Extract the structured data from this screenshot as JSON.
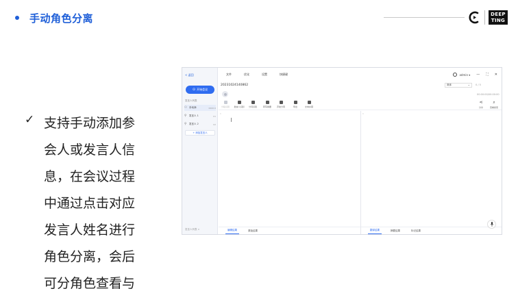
{
  "slide": {
    "title": "手动角色分离",
    "logo": {
      "brand_line1": "DEEP",
      "brand_line2": "TING"
    },
    "check_glyph": "✓",
    "description_lines": [
      "支持手动添加参",
      "会人或发言人信",
      "息，在会议过程",
      "中通过点击对应",
      "发言人姓名进行",
      "角色分离，会后",
      "可分角色查看与"
    ]
  },
  "app": {
    "sidebar": {
      "back_label": "< 返回",
      "start_button": "开始会议",
      "section_label": "发言人列表",
      "speakers": [
        {
          "name": "手动添",
          "count": "0000:0",
          "icon": "user-list-icon"
        },
        {
          "name": "发言人 1",
          "count": "01",
          "icon": "user-icon"
        },
        {
          "name": "发言人 2",
          "count": "02",
          "icon": "user-icon"
        }
      ],
      "add_speaker_label": "+ 添加发言人",
      "footer": "发言人列表 ∨"
    },
    "menu": [
      "文件",
      "优化",
      "设置",
      "快捷键"
    ],
    "user": {
      "name": "admin ▾"
    },
    "window_controls": {
      "minimize": "—",
      "maximize": "⛶",
      "close": "✕"
    },
    "meeting_id": "20231024140862",
    "language": "简体",
    "counter": "0 / 5",
    "timecode": "00:00:00/00:00:00",
    "tools": [
      {
        "label": "分段识别",
        "disabled": true
      },
      {
        "label": "发言人识别",
        "disabled": false
      },
      {
        "label": "分词识别",
        "disabled": false
      },
      {
        "label": "转写摘要",
        "disabled": false
      },
      {
        "label": "声纹分离",
        "disabled": false
      },
      {
        "label": "导出",
        "disabled": false
      },
      {
        "label": "文本纠错",
        "disabled": false
      }
    ],
    "tools_right": [
      {
        "glyph": "⋖",
        "label": "分享"
      },
      {
        "glyph": "⌕",
        "label": "查看搜索"
      }
    ],
    "left_pane_number": "1",
    "right_pane_number": "1",
    "tabs_left": [
      "编辑结果",
      "原始结果"
    ],
    "tabs_right": [
      "翻译结果",
      "摘要结果",
      "标记结果"
    ],
    "mic_glyph": "🎙"
  }
}
